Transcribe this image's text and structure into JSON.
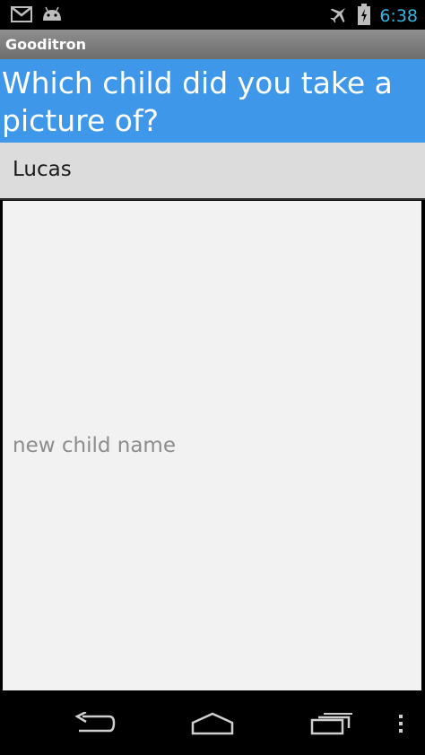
{
  "status_bar": {
    "time": "6:38",
    "icons": [
      "gmail-icon",
      "android-debug-icon",
      "airplane-mode-icon",
      "battery-charging-icon"
    ]
  },
  "app": {
    "title": "Gooditron"
  },
  "question": {
    "text": "Which child did you take a picture of?"
  },
  "children": [
    {
      "name": "Lucas"
    }
  ],
  "new_child": {
    "placeholder": "new child name",
    "value": ""
  },
  "nav": {
    "icons": [
      "back-icon",
      "home-icon",
      "recent-apps-icon",
      "menu-overflow-icon"
    ]
  }
}
